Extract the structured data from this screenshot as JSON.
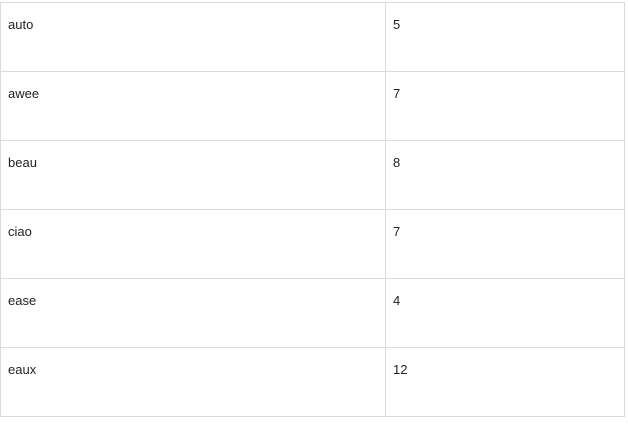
{
  "table": {
    "rows": [
      {
        "word": "auto",
        "count": "5"
      },
      {
        "word": "awee",
        "count": "7"
      },
      {
        "word": "beau",
        "count": "8"
      },
      {
        "word": "ciao",
        "count": "7"
      },
      {
        "word": "ease",
        "count": "4"
      },
      {
        "word": "eaux",
        "count": "12"
      }
    ]
  }
}
